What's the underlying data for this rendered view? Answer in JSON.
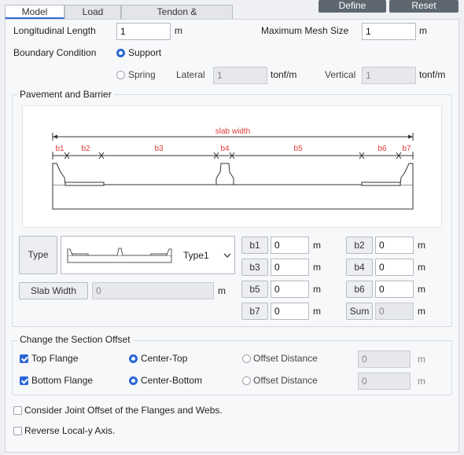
{
  "tabs": [
    "Model",
    "Load",
    "Tendon & Reinforcement"
  ],
  "header_buttons": {
    "define": "Define",
    "reset": "Reset"
  },
  "longitudinal": {
    "label": "Longitudinal Length",
    "value": "1",
    "unit": "m"
  },
  "mesh": {
    "label": "Maximum Mesh Size",
    "value": "1",
    "unit": "m"
  },
  "boundary": {
    "label": "Boundary Condition",
    "support": "Support",
    "spring": "Spring",
    "lateral_label": "Lateral",
    "lateral_value": "1",
    "lateral_unit": "tonf/m",
    "vertical_label": "Vertical",
    "vertical_value": "1",
    "vertical_unit": "tonf/m"
  },
  "pavement": {
    "title": "Pavement and Barrier",
    "diagram": {
      "slab_width": "slab width",
      "labels": [
        "b1",
        "b2",
        "b3",
        "b4",
        "b5",
        "b6",
        "b7"
      ],
      "label_color": "#e03a3a"
    },
    "type_button": "Type",
    "type_value": "Type1",
    "slab_width_button": "Slab Width",
    "slab_width_value": "0",
    "slab_width_unit": "m",
    "fields": [
      {
        "label": "b1",
        "value": "0",
        "unit": "m"
      },
      {
        "label": "b2",
        "value": "0",
        "unit": "m"
      },
      {
        "label": "b3",
        "value": "0",
        "unit": "m"
      },
      {
        "label": "b4",
        "value": "0",
        "unit": "m"
      },
      {
        "label": "b5",
        "value": "0",
        "unit": "m"
      },
      {
        "label": "b6",
        "value": "0",
        "unit": "m"
      },
      {
        "label": "b7",
        "value": "0",
        "unit": "m"
      },
      {
        "label": "Sum",
        "value": "0",
        "unit": "m"
      }
    ]
  },
  "offset": {
    "title": "Change the Section Offset",
    "top_flange": "Top Flange",
    "bottom_flange": "Bottom Flange",
    "center_top": "Center-Top",
    "center_bottom": "Center-Bottom",
    "offset_distance": "Offset Distance",
    "offset_value_1": "0",
    "offset_value_2": "0",
    "unit": "m"
  },
  "options": {
    "joint_offset": "Consider Joint Offset of the Flanges and Webs.",
    "reverse_local_y": "Reverse Local-y Axis."
  },
  "colors": {
    "accent": "#2a66d6",
    "header_button": "#5e6670"
  }
}
